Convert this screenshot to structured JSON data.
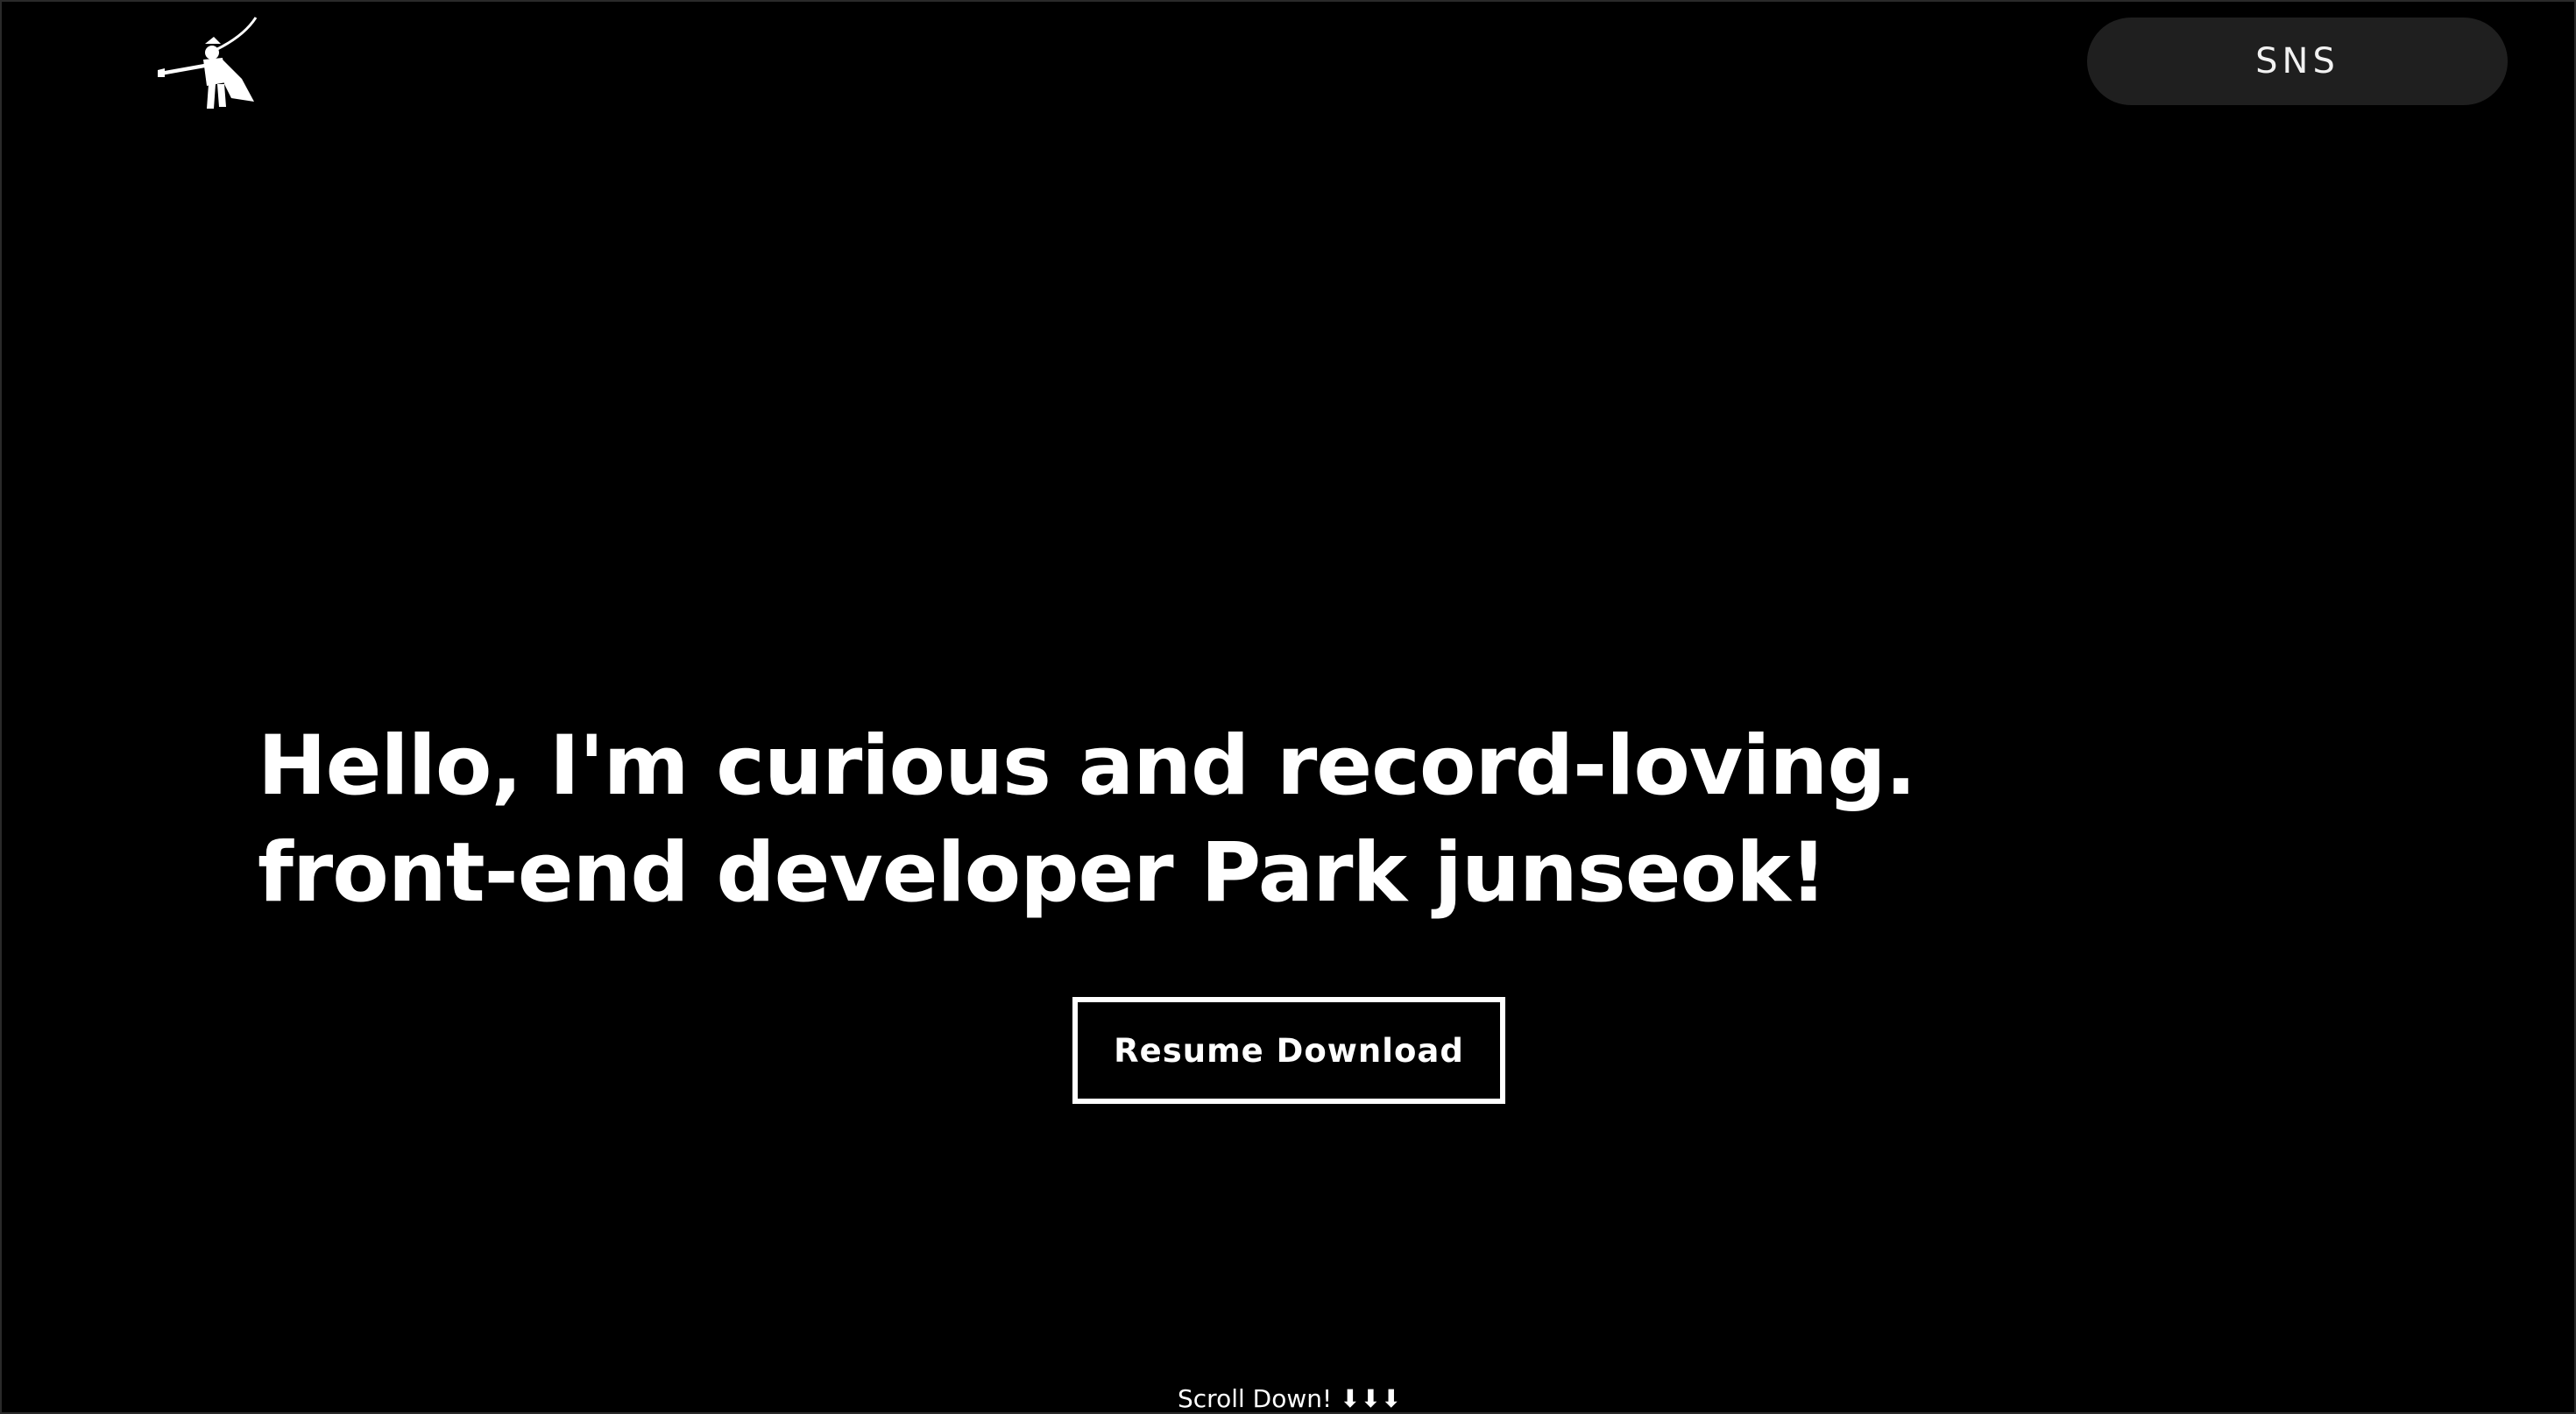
{
  "header": {
    "logo_icon": "trumpeter-logo-icon",
    "sns_label": "SNS"
  },
  "hero": {
    "line1": "Hello, I'm curious and record-loving.",
    "line2": "front-end developer Park junseok!",
    "resume_label": "Resume Download"
  },
  "footer": {
    "scroll_hint": "Scroll Down! ⬇⬇⬇"
  },
  "colors": {
    "background": "#000000",
    "text": "#ffffff",
    "sns_button_bg": "#1f1f1f"
  }
}
